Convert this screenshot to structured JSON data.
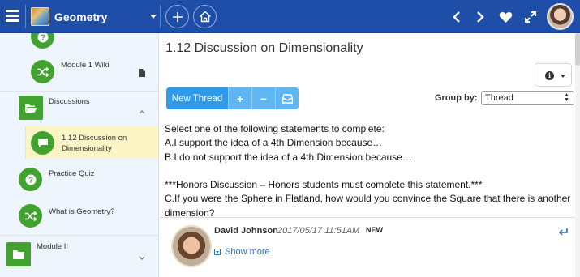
{
  "topbar": {
    "course_title": "Geometry",
    "icons": [
      "menu-icon",
      "plus-icon",
      "home-icon",
      "chevron-left-icon",
      "chevron-right-icon",
      "heart-icon",
      "expand-icon"
    ]
  },
  "sidebar": {
    "items": [
      {
        "label": "Module 1 Wiki",
        "icon": "shuffle-icon",
        "trailing_icon": "document-icon"
      },
      {
        "label": "Discussions",
        "icon": "folder-open-icon",
        "trailing_icon": "chevron-up-icon"
      },
      {
        "label": "1.12 Discussion on Dimensionality",
        "icon": "chat-bubble-icon",
        "active": true
      },
      {
        "label": "Practice Quiz",
        "icon": "question-icon"
      },
      {
        "label": "What is Geometry?",
        "icon": "shuffle-icon"
      },
      {
        "label": "Module II",
        "icon": "folder-icon",
        "trailing_icon": "chevron-down-icon"
      }
    ]
  },
  "main": {
    "title": "1.12 Discussion on Dimensionality",
    "toolbar": {
      "new_thread_label": "New Thread",
      "expand_label": "+",
      "collapse_label": "−",
      "inbox_label": ""
    },
    "group_by": {
      "label": "Group by:",
      "selected": "Thread"
    },
    "prompt_lines": [
      "Select one of the following statements to complete:",
      "A.I support the idea of a 4th Dimension because…",
      "B.I do not support the idea of a 4th Dimension because…",
      "",
      "***Honors Discussion – Honors students must complete this statement.***",
      "C.If you were the Sphere in Flatland, how would you convince the Square that there is another dimension?"
    ],
    "post": {
      "author": "David Johnson",
      "date": "2017/05/17 11:51AM",
      "badge": "NEW",
      "show_more": "Show more"
    }
  },
  "colors": {
    "topbar": "#1f4ea8",
    "accent_green": "#41a22f",
    "button_blue": "#2f9be8",
    "active_highlight": "#fbf4c4",
    "sidebar_bg": "#eef5fc"
  }
}
